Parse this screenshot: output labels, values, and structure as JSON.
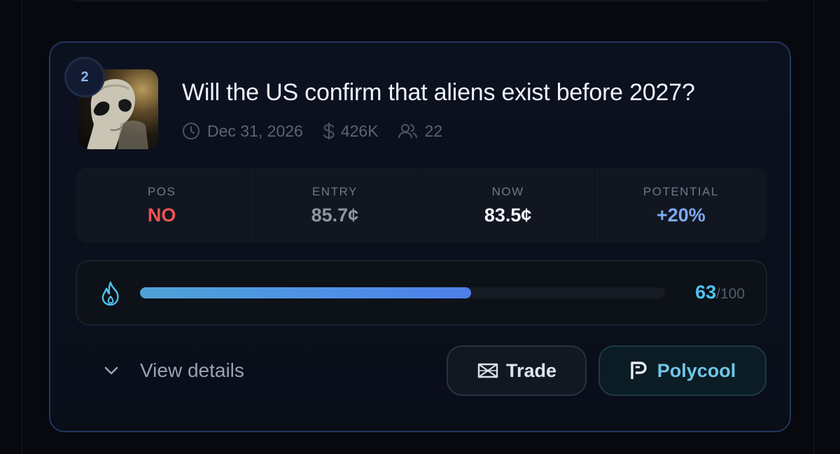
{
  "market": {
    "rank": "2",
    "title": "Will the US confirm that aliens exist before 2027?",
    "end_date": "Dec 31, 2026",
    "volume": "426K",
    "traders": "22",
    "image_icon": "alien-thumbnail"
  },
  "stats": {
    "pos_label": "POS",
    "pos_value": "NO",
    "entry_label": "ENTRY",
    "entry_value": "85.7¢",
    "now_label": "NOW",
    "now_value": "83.5¢",
    "potential_label": "POTENTIAL",
    "potential_value": "+20%"
  },
  "score": {
    "icon": "flame-icon",
    "value": "63",
    "max": "/100",
    "fraction": 0.63
  },
  "actions": {
    "details_label": "View details",
    "trade_label": "Trade",
    "polycool_label": "Polycool"
  },
  "colors": {
    "no": "#ea5454",
    "potential": "#7ea9f4",
    "score": "#4fc3f0",
    "card_border": "#23365e"
  }
}
